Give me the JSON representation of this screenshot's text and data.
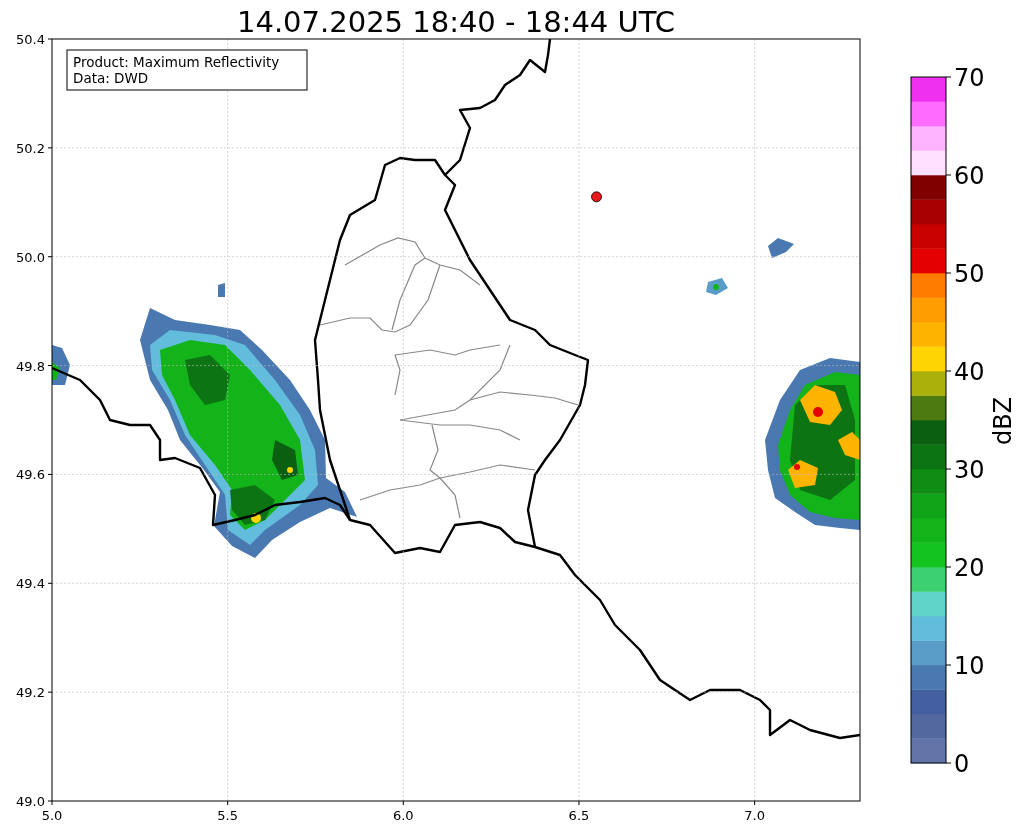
{
  "figure": {
    "title": "14.07.2025 18:40 - 18:44 UTC"
  },
  "info_box": {
    "lines": [
      "Product: Maximum Reflectivity",
      "Data: DWD"
    ]
  },
  "map": {
    "chart_data": {
      "type": "scatter",
      "grid": true,
      "xlim": [
        5.0,
        7.3
      ],
      "ylim": [
        49.0,
        50.4
      ],
      "xticks": [
        {
          "value": 5.0,
          "label": "5.0"
        },
        {
          "value": 5.5,
          "label": "5.5"
        },
        {
          "value": 6.0,
          "label": "6.0"
        },
        {
          "value": 6.5,
          "label": "6.5"
        },
        {
          "value": 7.0,
          "label": "7.0"
        }
      ],
      "yticks": [
        {
          "value": 49.0,
          "label": "49.0"
        },
        {
          "value": 49.2,
          "label": "49.2"
        },
        {
          "value": 49.4,
          "label": "49.4"
        },
        {
          "value": 49.6,
          "label": "49.6"
        },
        {
          "value": 49.8,
          "label": "49.8"
        },
        {
          "value": 50.0,
          "label": "50.0"
        },
        {
          "value": 50.2,
          "label": "50.2"
        },
        {
          "value": 50.4,
          "label": "50.4"
        }
      ],
      "series": [
        {
          "color": "#e41a1c",
          "x": [
            6.55
          ],
          "values": [
            50.11
          ]
        }
      ]
    }
  },
  "colorbar": {
    "label": "dBZ",
    "ticks": [
      "70",
      "60",
      "50",
      "40",
      "30",
      "20",
      "10",
      "0"
    ],
    "bins": [
      {
        "color": "#6274a8"
      },
      {
        "color": "#5468a0"
      },
      {
        "color": "#4560a0"
      },
      {
        "color": "#4a78b0"
      },
      {
        "color": "#5a9cc8"
      },
      {
        "color": "#62bcdc"
      },
      {
        "color": "#60d4c8"
      },
      {
        "color": "#3cd070"
      },
      {
        "color": "#14c41e"
      },
      {
        "color": "#12b41a"
      },
      {
        "color": "#10a418"
      },
      {
        "color": "#0e8c14"
      },
      {
        "color": "#0c7412"
      },
      {
        "color": "#0a6010"
      },
      {
        "color": "#4c7a10"
      },
      {
        "color": "#acb00a"
      },
      {
        "color": "#ffd400"
      },
      {
        "color": "#ffb400"
      },
      {
        "color": "#ff9c00"
      },
      {
        "color": "#ff7c00"
      },
      {
        "color": "#e40000"
      },
      {
        "color": "#c80000"
      },
      {
        "color": "#a80000"
      },
      {
        "color": "#800000"
      },
      {
        "color": "#ffe0ff"
      },
      {
        "color": "#ffb4ff"
      },
      {
        "color": "#ff6cff"
      },
      {
        "color": "#f030f0"
      }
    ]
  }
}
